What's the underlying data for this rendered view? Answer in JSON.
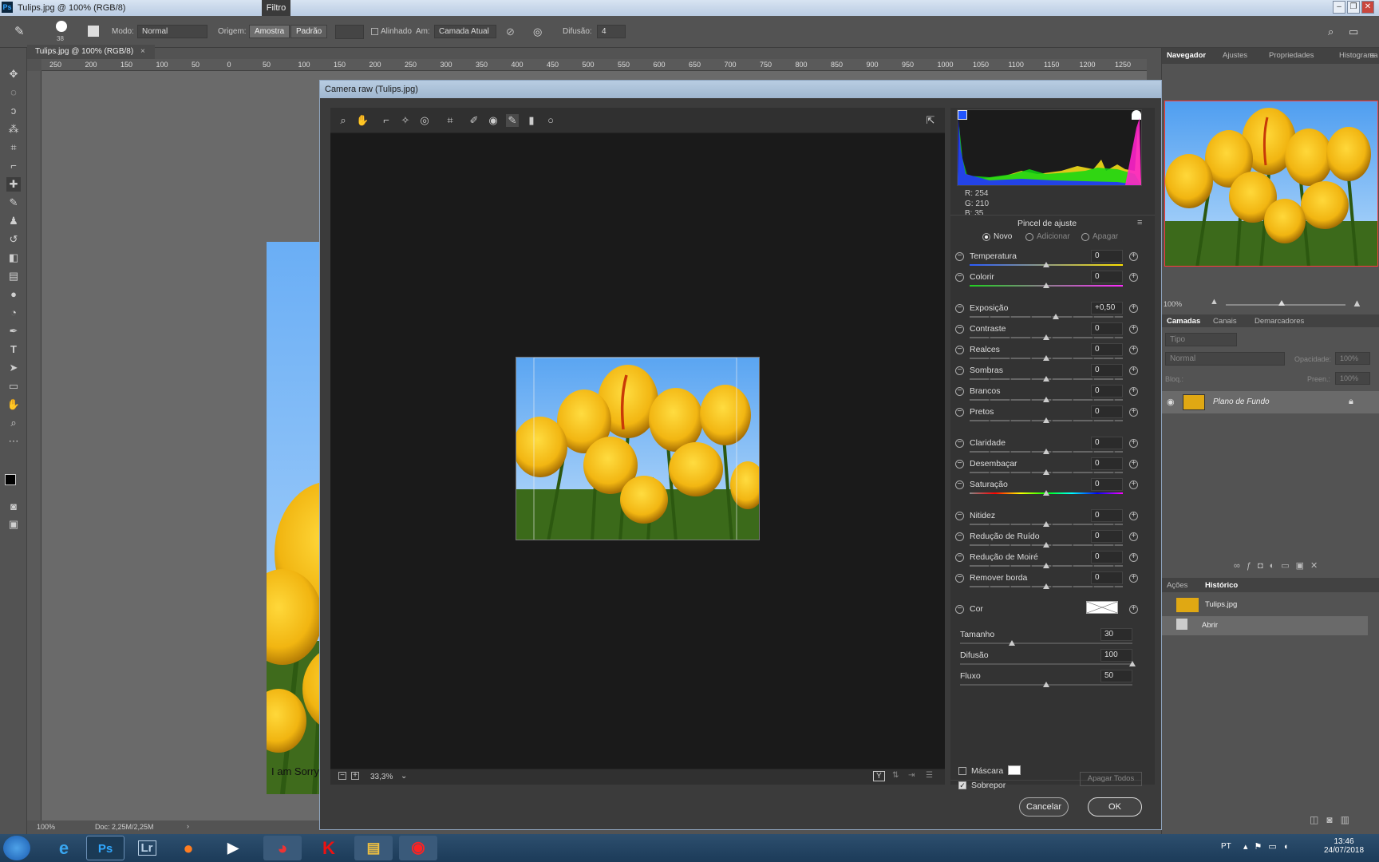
{
  "titlebar": {
    "title": "Tulips.jpg @ 100% (RGB/8)",
    "menu_active": "Filtro"
  },
  "options": {
    "size_value": "38",
    "mode_label": "Modo:",
    "mode_value": "Normal",
    "origin_label": "Origem:",
    "sample_button": "Amostra",
    "pattern_button": "Padrão",
    "aligned_label": "Alinhado",
    "sample_label": "Am:",
    "sample_value": "Camada Atual",
    "diffusion_label": "Difusão:",
    "diffusion_value": "4"
  },
  "document": {
    "tab_label": "Tulips.jpg @ 100% (RGB/8)",
    "ruler_ticks": [
      "250",
      "200",
      "150",
      "100",
      "50",
      "0",
      "50",
      "100",
      "150",
      "200",
      "250",
      "300",
      "350",
      "400",
      "450",
      "500",
      "550",
      "600",
      "650",
      "700",
      "750",
      "800",
      "850",
      "900",
      "950",
      "1000",
      "1050",
      "1100",
      "1150",
      "1200",
      "1250"
    ],
    "overlay_text": "I am Sorry !!!!!",
    "zoom": "100%",
    "doc_info": "Doc: 2,25M/2,25M"
  },
  "camera_raw": {
    "title": "Camera raw (Tulips.jpg)",
    "rgb": {
      "r_label": "R:",
      "r": "254",
      "g_label": "G:",
      "g": "210",
      "b_label": "B:",
      "b": "35"
    },
    "panel_title": "Pincel de ajuste",
    "modes": [
      "Novo",
      "Adicionar",
      "Apagar"
    ],
    "sliders": [
      {
        "name": "Temperatura",
        "value": "0",
        "pos": 0.5,
        "track": "temp"
      },
      {
        "name": "Colorir",
        "value": "0",
        "pos": 0.5,
        "track": "tint"
      },
      {
        "name": "Exposição",
        "value": "+0,50",
        "pos": 0.56,
        "track": "gray"
      },
      {
        "name": "Contraste",
        "value": "0",
        "pos": 0.5,
        "track": "gray"
      },
      {
        "name": "Realces",
        "value": "0",
        "pos": 0.5,
        "track": "gray"
      },
      {
        "name": "Sombras",
        "value": "0",
        "pos": 0.5,
        "track": "gray"
      },
      {
        "name": "Brancos",
        "value": "0",
        "pos": 0.5,
        "track": "gray"
      },
      {
        "name": "Pretos",
        "value": "0",
        "pos": 0.5,
        "track": "gray"
      },
      {
        "name": "Claridade",
        "value": "0",
        "pos": 0.5,
        "track": "gray"
      },
      {
        "name": "Desembaçar",
        "value": "0",
        "pos": 0.5,
        "track": "gray"
      },
      {
        "name": "Saturação",
        "value": "0",
        "pos": 0.5,
        "track": "sat"
      },
      {
        "name": "Nitidez",
        "value": "0",
        "pos": 0.5,
        "track": "gray"
      },
      {
        "name": "Redução de Ruído",
        "value": "0",
        "pos": 0.5,
        "track": "gray"
      },
      {
        "name": "Redução de Moiré",
        "value": "0",
        "pos": 0.5,
        "track": "gray"
      },
      {
        "name": "Remover borda",
        "value": "0",
        "pos": 0.5,
        "track": "gray"
      }
    ],
    "color_label": "Cor",
    "brush": [
      {
        "name": "Tamanho",
        "value": "30",
        "pos": 0.3
      },
      {
        "name": "Difusão",
        "value": "100",
        "pos": 1.0
      },
      {
        "name": "Fluxo",
        "value": "50",
        "pos": 0.5
      }
    ],
    "mask_label": "Máscara",
    "overlay_label": "Sobrepor",
    "clear_all": "Apagar Todos",
    "zoom_value": "33,3%",
    "cancel": "Cancelar",
    "ok": "OK"
  },
  "right_panel": {
    "tabs": [
      "Navegador",
      "Ajustes",
      "Propriedades",
      "Histograma"
    ],
    "nav_zoom": "100%",
    "layer_tabs": [
      "Camadas",
      "Canais",
      "Demarcadores"
    ],
    "kind_placeholder": "Tipo",
    "blend_mode": "Normal",
    "opacity_label": "Opacidade:",
    "opacity_value": "100%",
    "lock_label": "Bloq.:",
    "fill_label": "Preen.:",
    "fill_value": "100%",
    "layer_name": "Plano de Fundo",
    "history_tabs": [
      "Ações",
      "Histórico"
    ],
    "history_items": [
      "Tulips.jpg",
      "Abrir"
    ]
  },
  "taskbar": {
    "apps": [
      "Ps",
      "Lr"
    ],
    "lang": "PT",
    "time": "13:46",
    "date": "24/07/2018"
  }
}
